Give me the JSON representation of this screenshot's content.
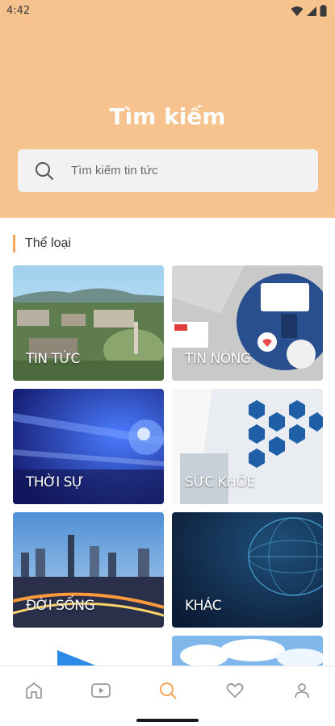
{
  "status_bar": {
    "time": "4:42"
  },
  "header": {
    "title": "Tìm kiếm"
  },
  "search": {
    "placeholder": "Tìm kiếm tin tức"
  },
  "section": {
    "title": "Thể loại"
  },
  "categories": [
    {
      "label": "TIN TỨC"
    },
    {
      "label": "TIN NÓNG"
    },
    {
      "label": "THỜI SỰ"
    },
    {
      "label": "SỨC KHỎE"
    },
    {
      "label": "ĐỜI SỐNG"
    },
    {
      "label": "KHÁC"
    }
  ],
  "bottom_nav": {
    "items": [
      {
        "icon": "home-icon"
      },
      {
        "icon": "video-icon"
      },
      {
        "icon": "search-icon",
        "active": true
      },
      {
        "icon": "heart-icon"
      },
      {
        "icon": "user-icon"
      }
    ],
    "active_color": "#f5a55a",
    "inactive_color": "#9a9a9a"
  },
  "colors": {
    "header_bg": "#f6c28e",
    "accent": "#f5a55a"
  }
}
